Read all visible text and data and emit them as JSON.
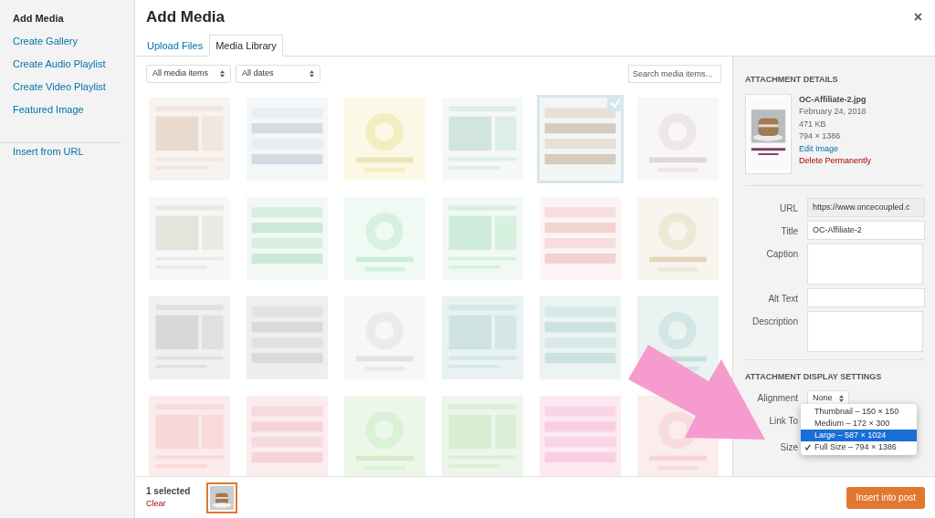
{
  "sidebar": {
    "title": "Add Media",
    "items": [
      {
        "label": "Create Gallery"
      },
      {
        "label": "Create Audio Playlist"
      },
      {
        "label": "Create Video Playlist"
      },
      {
        "label": "Featured Image"
      },
      {
        "label": "Insert from URL"
      }
    ]
  },
  "modal": {
    "title": "Add Media",
    "close": "×"
  },
  "tabs": [
    {
      "label": "Upload Files",
      "selected": false
    },
    {
      "label": "Media Library",
      "selected": true
    }
  ],
  "toolbar": {
    "filters": [
      {
        "value": "All media items"
      },
      {
        "value": "All dates"
      }
    ],
    "search": {
      "placeholder": "Search media items..."
    }
  },
  "grid": [
    {
      "kind": "picture",
      "selected": false
    },
    {
      "kind": "picture",
      "selected": false
    },
    {
      "kind": "picture",
      "selected": false
    },
    {
      "kind": "picture",
      "selected": false
    },
    {
      "kind": "picture",
      "selected": true
    },
    {
      "kind": "picture",
      "selected": false
    },
    {
      "kind": "picture",
      "selected": false
    },
    {
      "kind": "picture",
      "selected": false
    },
    {
      "kind": "picture",
      "selected": false
    },
    {
      "kind": "picture",
      "selected": false
    },
    {
      "kind": "picture",
      "selected": false
    },
    {
      "kind": "picture",
      "selected": false
    },
    {
      "kind": "picture",
      "selected": false
    },
    {
      "kind": "picture",
      "selected": false
    },
    {
      "kind": "picture",
      "selected": false
    },
    {
      "kind": "picture",
      "selected": false
    },
    {
      "kind": "picture",
      "selected": false
    },
    {
      "kind": "picture",
      "selected": false
    },
    {
      "kind": "picture",
      "selected": false
    },
    {
      "kind": "picture",
      "selected": false
    },
    {
      "kind": "picture",
      "selected": false
    },
    {
      "kind": "picture",
      "selected": false
    },
    {
      "kind": "picture",
      "selected": false
    },
    {
      "kind": "picture",
      "selected": false
    }
  ],
  "details": {
    "heading": "ATTACHMENT DETAILS",
    "filename": "OC-Affiliate-2.jpg",
    "date": "February 24, 2018",
    "size": "471 KB",
    "dimensions": "794 × 1386",
    "edit": "Edit Image",
    "delete": "Delete Permanently",
    "fields": [
      {
        "label": "URL",
        "kind": "readonly",
        "value": "https://www.oncecoupled.c"
      },
      {
        "label": "Title",
        "kind": "input",
        "value": "OC-Affiliate-2"
      },
      {
        "label": "Caption",
        "kind": "textarea"
      },
      {
        "label": "Alt Text",
        "kind": "input"
      },
      {
        "label": "Description",
        "kind": "textarea"
      }
    ]
  },
  "display_settings": {
    "heading": "ATTACHMENT DISPLAY SETTINGS",
    "alignment": {
      "label": "Alignment",
      "value": "None"
    },
    "link_to": {
      "label": "Link To"
    },
    "size": {
      "label": "Size"
    },
    "size_options": [
      {
        "label": "Thumbnail – 150 × 150",
        "selected": false,
        "checked": false
      },
      {
        "label": "Medium – 172 × 300",
        "selected": false,
        "checked": false
      },
      {
        "label": "Large – 587 × 1024",
        "selected": true,
        "checked": false
      },
      {
        "label": "Full Size – 794 × 1386",
        "selected": false,
        "checked": true
      }
    ]
  },
  "footer": {
    "count": "1 selected",
    "clear": "Clear",
    "insert": "Insert into post"
  }
}
